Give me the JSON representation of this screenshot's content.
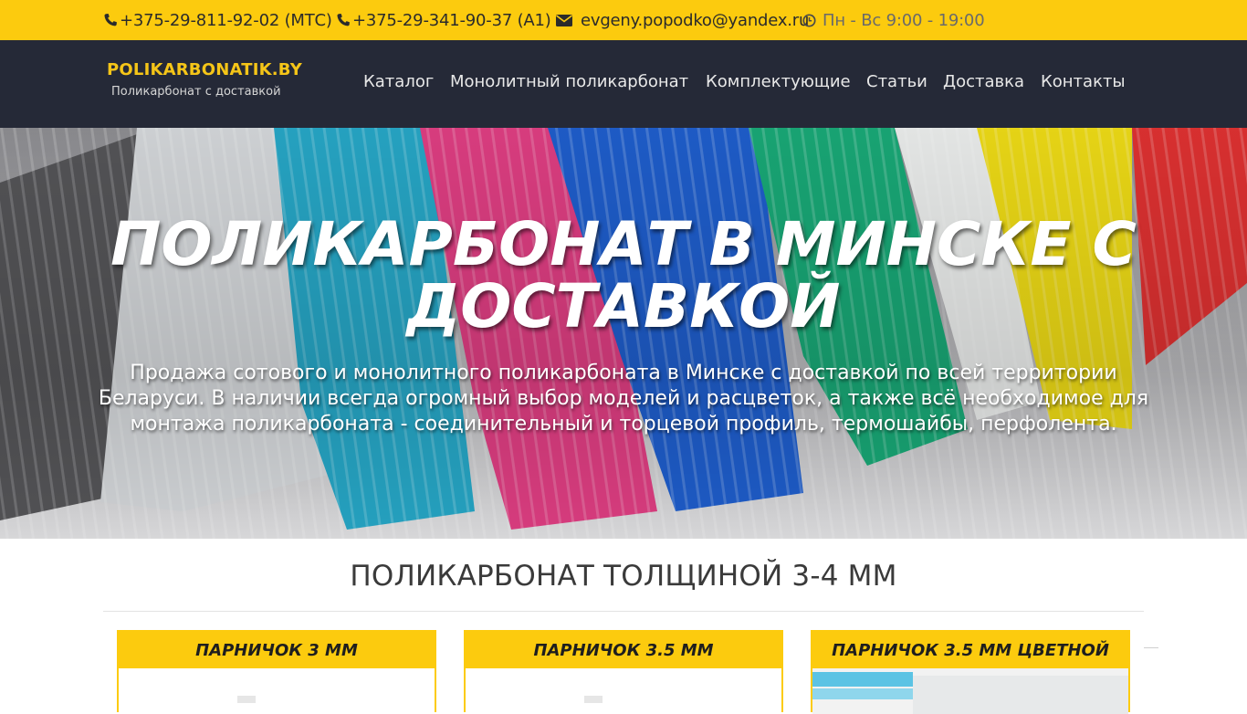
{
  "topbar": {
    "phone_mts": "+375-29-811-92-02 (МТС)",
    "phone_a1": "+375-29-341-90-37 (A1)",
    "email": "evgeny.popodko@yandex.ru",
    "hours": "Пн - Вс 9:00 - 19:00"
  },
  "header": {
    "logo_title": "POLIKARBONATIK.BY",
    "logo_subtitle": "Поликарбонат с доставкой",
    "nav": [
      "Каталог",
      "Монолитный поликарбонат",
      "Комплектующие",
      "Статьи",
      "Доставка",
      "Контакты"
    ]
  },
  "hero": {
    "title_line1": "ПОЛИКАРБОНАТ В МИНСКЕ С",
    "title_line2": "ДОСТАВКОЙ",
    "description": "Продажа сотового и монолитного поликарбоната в Минске с доставкой по всей территории Беларуси. В наличии всегда огромный выбор моделей и расцветок, а также всё необходимое для монтажа поликарбоната - соединительный и торцевой профиль, термошайбы, перфолента."
  },
  "section": {
    "title": "ПОЛИКАРБОНАТ ТОЛЩИНОЙ 3-4 ММ",
    "products": [
      {
        "name": "ПАРНИЧОК 3 ММ"
      },
      {
        "name": "ПАРНИЧОК 3.5 ММ"
      },
      {
        "name": "ПАРНИЧОК 3.5 ММ ЦВЕТНОЙ"
      }
    ]
  },
  "colors": {
    "accent_yellow": "#fccb0e",
    "nav_dark": "#252937",
    "logo_gold": "#f5c518"
  },
  "icons": [
    "phone-icon",
    "phone-icon",
    "envelope-icon",
    "clock-icon"
  ]
}
